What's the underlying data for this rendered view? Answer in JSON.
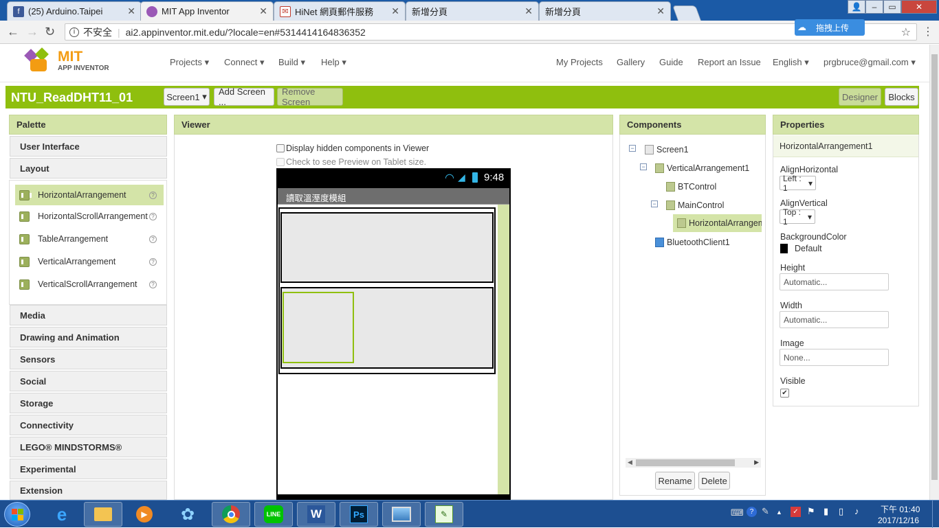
{
  "browser": {
    "tabs": [
      {
        "title": "(25) Arduino.Taipei",
        "icon": "facebook-icon",
        "color": "#3b5998"
      },
      {
        "title": "MIT App Inventor",
        "icon": "appinventor-icon",
        "color": "#9b59b6"
      },
      {
        "title": "HiNet 網頁郵件服務",
        "icon": "mail-icon",
        "color": "#c0392b"
      },
      {
        "title": "新增分頁",
        "icon": "",
        "color": ""
      },
      {
        "title": "新增分頁",
        "icon": "",
        "color": ""
      }
    ],
    "insecure_label": "不安全",
    "url": "ai2.appinventor.mit.edu/?locale=en#5314414164836352",
    "upload_label": "拖拽上传"
  },
  "header": {
    "logo_top": "MIT",
    "logo_bottom": "APP INVENTOR",
    "menus": [
      "Projects",
      "Connect",
      "Build",
      "Help"
    ],
    "links": [
      "My Projects",
      "Gallery",
      "Guide",
      "Report an Issue",
      "English",
      "prgbruce@gmail.com"
    ]
  },
  "project": {
    "name": "NTU_ReadDHT11_01",
    "screen_select": "Screen1",
    "add_screen": "Add Screen ...",
    "remove_screen": "Remove Screen",
    "designer": "Designer",
    "blocks": "Blocks"
  },
  "palette": {
    "title": "Palette",
    "categories_top": [
      "User Interface",
      "Layout"
    ],
    "layout_items": [
      {
        "label": "HorizontalArrangement"
      },
      {
        "label": "HorizontalScrollArrangement"
      },
      {
        "label": "TableArrangement"
      },
      {
        "label": "VerticalArrangement"
      },
      {
        "label": "VerticalScrollArrangement"
      }
    ],
    "categories_bottom": [
      "Media",
      "Drawing and Animation",
      "Sensors",
      "Social",
      "Storage",
      "Connectivity",
      "LEGO® MINDSTORMS®",
      "Experimental",
      "Extension"
    ]
  },
  "viewer": {
    "title": "Viewer",
    "display_hidden": "Display hidden components in Viewer",
    "tablet_preview": "Check to see Preview on Tablet size.",
    "clock": "9:48",
    "app_title": "讀取溫溼度模組"
  },
  "components": {
    "title": "Components",
    "tree": [
      "Screen1",
      "VerticalArrangement1",
      "BTControl",
      "MainControl",
      "HorizontalArrangement1",
      "BluetoothClient1"
    ],
    "rename": "Rename",
    "delete": "Delete"
  },
  "properties": {
    "title": "Properties",
    "selected": "HorizontalArrangement1",
    "align_horizontal_label": "AlignHorizontal",
    "align_horizontal_value": "Left : 1",
    "align_vertical_label": "AlignVertical",
    "align_vertical_value": "Top : 1",
    "bgcolor_label": "BackgroundColor",
    "bgcolor_value": "Default",
    "height_label": "Height",
    "height_value": "Automatic...",
    "width_label": "Width",
    "width_value": "Automatic...",
    "image_label": "Image",
    "image_value": "None...",
    "visible_label": "Visible",
    "visible_checked": true
  },
  "taskbar": {
    "time": "下午 01:40",
    "date": "2017/12/16"
  },
  "colors": {
    "accent_green": "#8fbf0e",
    "panel_head": "#d4e4a8",
    "selection_green": "#8fbf0e"
  }
}
